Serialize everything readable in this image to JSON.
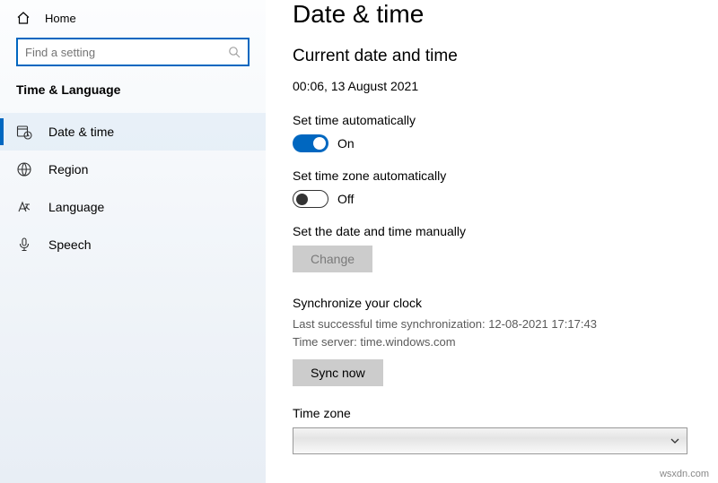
{
  "sidebar": {
    "home": "Home",
    "search_placeholder": "Find a setting",
    "section": "Time & Language",
    "items": [
      {
        "label": "Date & time"
      },
      {
        "label": "Region"
      },
      {
        "label": "Language"
      },
      {
        "label": "Speech"
      }
    ]
  },
  "main": {
    "title": "Date & time",
    "current_heading": "Current date and time",
    "current_value": "00:06, 13 August 2021",
    "set_time_auto": {
      "label": "Set time automatically",
      "state": "On"
    },
    "set_tz_auto": {
      "label": "Set time zone automatically",
      "state": "Off"
    },
    "manual": {
      "label": "Set the date and time manually",
      "button": "Change"
    },
    "sync": {
      "title": "Synchronize your clock",
      "last": "Last successful time synchronization: 12-08-2021 17:17:43",
      "server": "Time server: time.windows.com",
      "button": "Sync now"
    },
    "timezone": {
      "label": "Time zone"
    }
  },
  "watermark": "wsxdn.com"
}
